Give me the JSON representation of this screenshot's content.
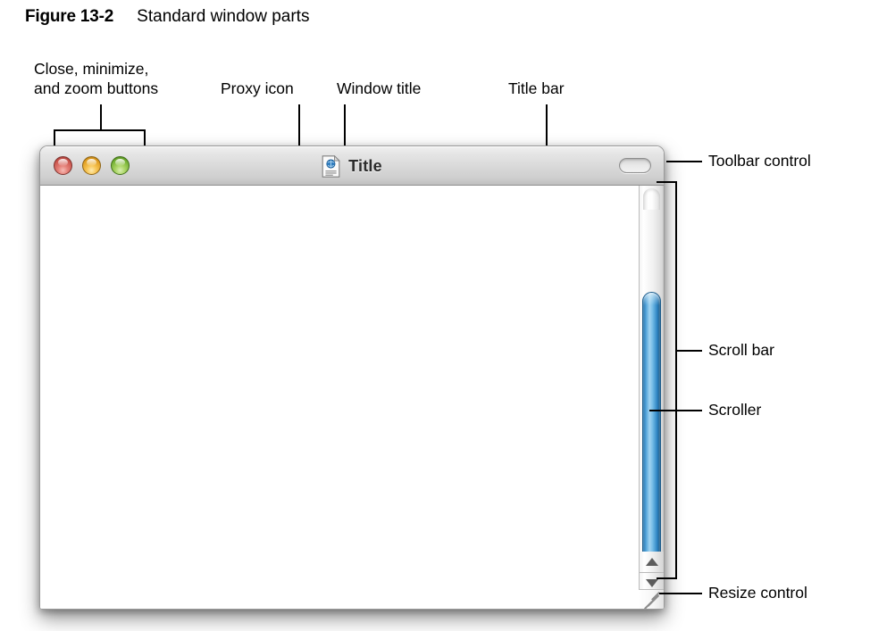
{
  "figure": {
    "number": "Figure 13-2",
    "title": "Standard window parts"
  },
  "callouts": {
    "buttons": "Close, minimize,\nand zoom buttons",
    "proxy_icon": "Proxy icon",
    "window_title": "Window title",
    "title_bar": "Title bar",
    "toolbar_control": "Toolbar control",
    "scroll_bar": "Scroll bar",
    "scroller": "Scroller",
    "resize_control": "Resize control"
  },
  "window": {
    "title": "Title",
    "buttons": [
      {
        "name": "close",
        "color": "#c9534b"
      },
      {
        "name": "minimize",
        "color": "#dd9a1e"
      },
      {
        "name": "zoom",
        "color": "#6fad2f"
      }
    ],
    "proxy_icon": "document-globe-icon",
    "toolbar_control": "toolbar-toggle-pill",
    "scroll": {
      "arrow_up": "triangle-up-icon",
      "arrow_down": "triangle-down-icon",
      "resize_grip": "resize-grip-icon"
    }
  },
  "colors": {
    "accent_scroller": "#4ea0d8",
    "titlebar_top": "#f0f0f0",
    "titlebar_bottom": "#bfbfbf",
    "leader_line": "#000000"
  }
}
